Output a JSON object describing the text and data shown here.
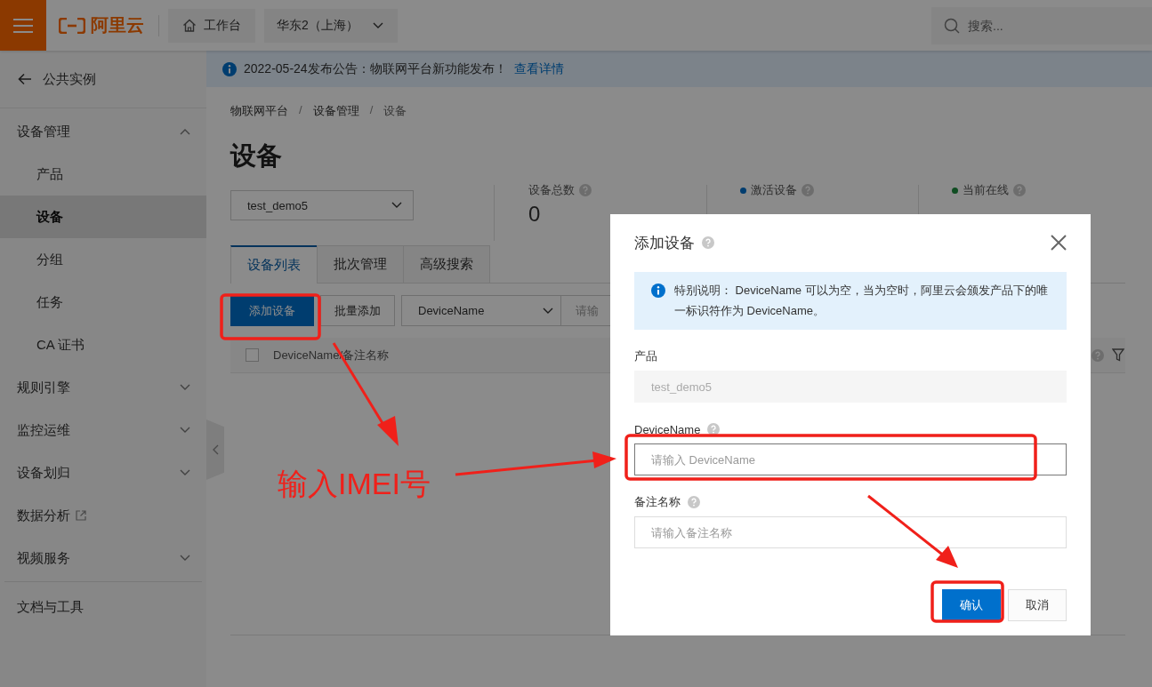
{
  "topbar": {
    "logo": "阿里云",
    "workbench": "工作台",
    "region": "华东2（上海）",
    "search": {
      "placeholder": "搜索..."
    }
  },
  "sidebar": {
    "back": "公共实例",
    "items": [
      {
        "label": "设备管理",
        "kind": "group",
        "expanded": true,
        "children": [
          {
            "label": "产品",
            "selected": false
          },
          {
            "label": "设备",
            "selected": true
          },
          {
            "label": "分组",
            "selected": false
          },
          {
            "label": "任务",
            "selected": false
          },
          {
            "label": "CA 证书",
            "selected": false
          }
        ]
      },
      {
        "label": "规则引擎",
        "kind": "group",
        "expanded": false
      },
      {
        "label": "监控运维",
        "kind": "group",
        "expanded": false
      },
      {
        "label": "设备划归",
        "kind": "group",
        "expanded": false
      },
      {
        "label": "数据分析",
        "kind": "external"
      },
      {
        "label": "视频服务",
        "kind": "group",
        "expanded": false
      }
    ],
    "footer_item": "文档与工具"
  },
  "notice": {
    "text": "2022-05-24发布公告：物联网平台新功能发布！",
    "link": "查看详情"
  },
  "breadcrumb": {
    "items": [
      "物联网平台",
      "设备管理",
      "设备"
    ],
    "separator": "/"
  },
  "page_title": "设备",
  "product_select": {
    "value": "test_demo5"
  },
  "stats": [
    {
      "label": "设备总数",
      "value": "0"
    },
    {
      "label": "激活设备",
      "color": "#003d6f"
    },
    {
      "label": "当前在线",
      "color": "#104d22"
    }
  ],
  "tabs": [
    {
      "label": "设备列表",
      "selected": true
    },
    {
      "label": "批次管理",
      "selected": false
    },
    {
      "label": "高级搜索",
      "selected": false
    }
  ],
  "toolbar": {
    "add_button": "添加设备",
    "batch_button": "批量添加",
    "field_select": "DeviceName",
    "search": {
      "placeholder": "请输"
    }
  },
  "table": {
    "select_all_checked": false,
    "columns": [
      "DeviceName/备注名称"
    ]
  },
  "dialog": {
    "title": "添加设备",
    "notice": "特别说明： DeviceName 可以为空，当为空时，阿里云会颁发产品下的唯一标识符作为 DeviceName。",
    "fields": [
      {
        "label": "产品",
        "value": "test_demo5",
        "disabled": true,
        "help": false,
        "focused": false
      },
      {
        "label": "DeviceName",
        "placeholder": "请输入 DeviceName",
        "disabled": false,
        "help": true,
        "focused": true
      },
      {
        "label": "备注名称",
        "placeholder": "请输入备注名称",
        "disabled": false,
        "help": true,
        "focused": false
      }
    ],
    "buttons": [
      {
        "label": "确认",
        "kind": "primary"
      },
      {
        "label": "取消",
        "kind": "secondary"
      }
    ]
  },
  "annotation": {
    "text": "输入IMEI号"
  }
}
